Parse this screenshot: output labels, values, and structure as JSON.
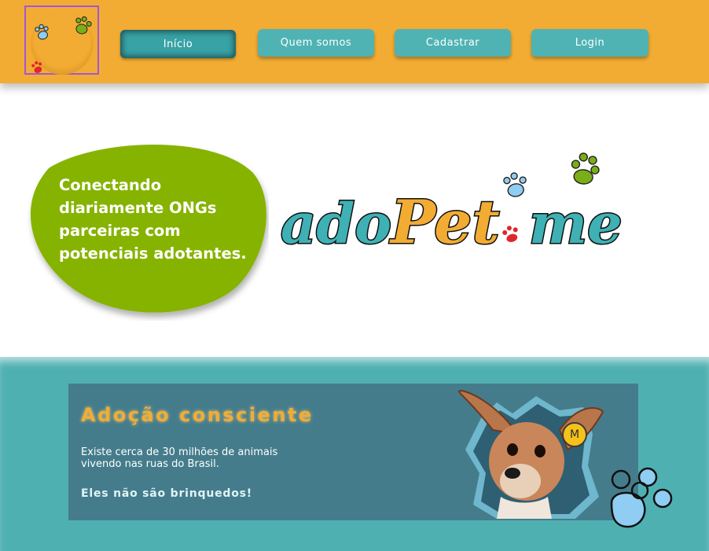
{
  "header": {
    "logo_icon": "paw-prints-logo",
    "nav": [
      {
        "label": "Início",
        "active": true
      },
      {
        "label": "Quem somos",
        "active": false
      },
      {
        "label": "Cadastrar",
        "active": false
      },
      {
        "label": "Login",
        "active": false
      }
    ]
  },
  "hero": {
    "tagline": "Conectando diariamente ONGs parceiras com potenciais adotantes.",
    "brand": {
      "part1": "ado",
      "part2": "Pet",
      "part3": "me"
    }
  },
  "adoption": {
    "title": "Adoção consciente",
    "text": "Existe cerca de 30 milhões de animais vivendo nas ruas do Brasil.",
    "emphasis": "Eles não são brinquedos!",
    "badge": "M"
  },
  "colors": {
    "header_bg": "#f2ac33",
    "button_bg": "#4fb3b4",
    "blob_green": "#86b300",
    "teal_band": "#4fb0b2",
    "card_bg": "#457c8c",
    "brand_teal": "#3fb1b5",
    "brand_orange": "#f2ac33"
  }
}
